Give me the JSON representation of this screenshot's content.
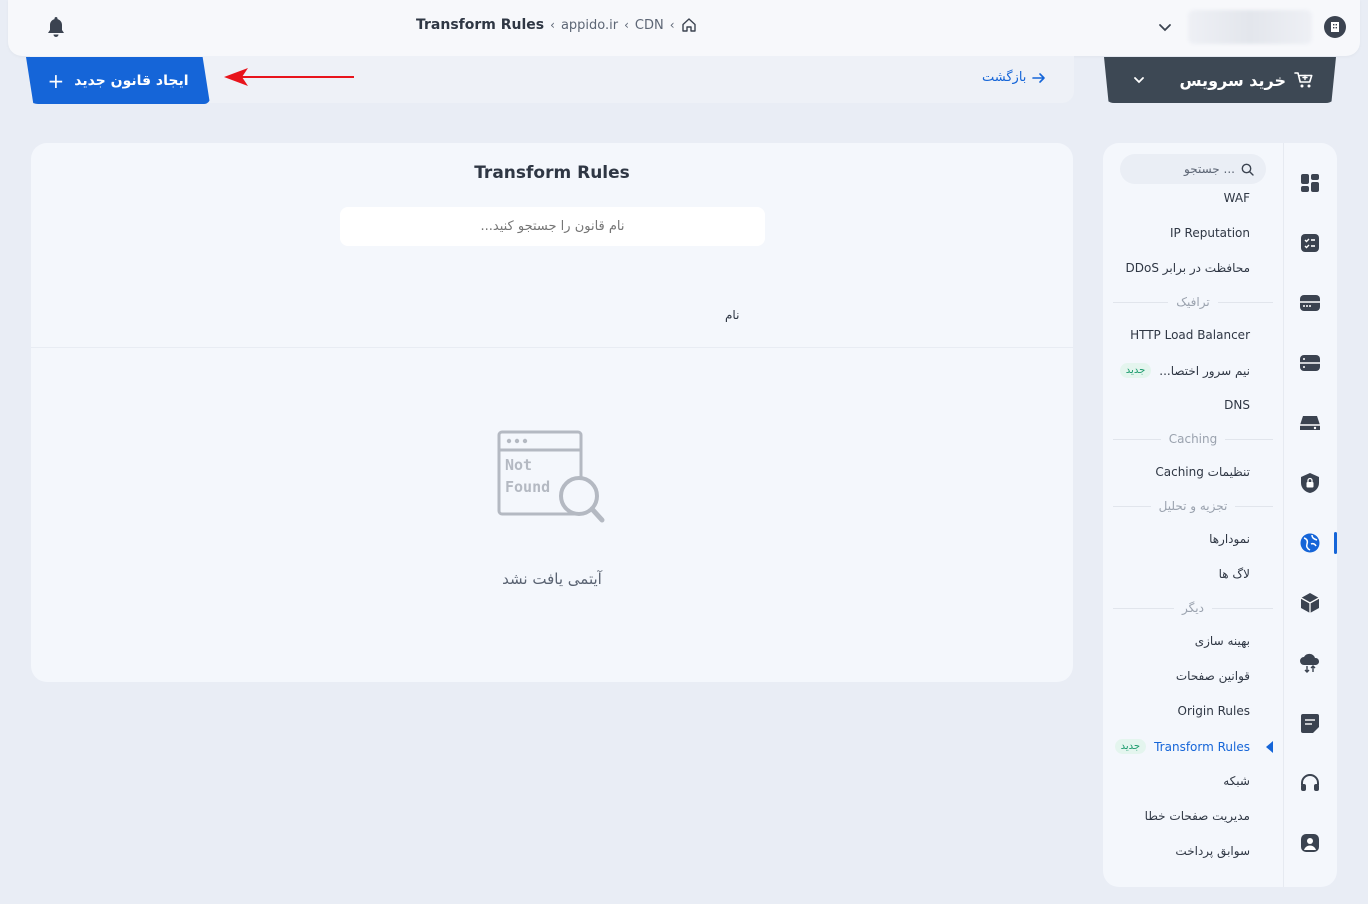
{
  "breadcrumb": {
    "current": "Transform Rules",
    "domain": "appido.ir",
    "section": "CDN"
  },
  "actions": {
    "create_label": "ایجاد قانون جدید",
    "back_label": "بازگشت",
    "buy_label": "خرید سرویس"
  },
  "main": {
    "title": "Transform Rules",
    "search_placeholder": "نام قانون را جستجو کنید...",
    "column_name": "نام",
    "empty_image_line1": "Not",
    "empty_image_line2": "Found",
    "empty_text": "آیتمی یافت نشد"
  },
  "sidebar": {
    "search_placeholder": "جستجو ...",
    "items": {
      "waf": "WAF",
      "ip_reputation": "IP Reputation",
      "ddos": "محافظت در برابر DDoS",
      "section_traffic": "ترافیک",
      "http_lb": "HTTP Load Balancer",
      "nameserver": "نیم سرور اختصا...",
      "nameserver_badge": "جدید",
      "dns": "DNS",
      "section_caching": "Caching",
      "caching_settings": "تنظیمات Caching",
      "section_analytics": "تجزیه و تحلیل",
      "charts": "نمودارها",
      "logs": "لاگ ها",
      "section_other": "دیگر",
      "optimization": "بهینه سازی",
      "page_rules": "قوانین صفحات",
      "origin_rules": "Origin Rules",
      "transform_rules": "Transform Rules",
      "transform_badge": "جدید",
      "network": "شبکه",
      "error_pages": "مدیریت صفحات خطا",
      "payment_history": "سوابق پرداخت"
    }
  },
  "colors": {
    "primary": "#1565d8",
    "dark_button": "#3d4854",
    "annotation_arrow": "#e8141c",
    "badge_green": "#1a9a6c"
  }
}
